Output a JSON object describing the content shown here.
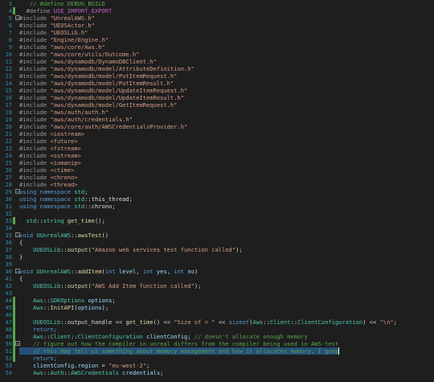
{
  "editor": {
    "theme": {
      "background": "#1e1e1e",
      "line_number": "#2b91af",
      "comment": "#57a64a",
      "preprocessor": "#9b9b9b",
      "macro": "#bd63c5",
      "string": "#d69d85",
      "keyword": "#569cd6",
      "type": "#4ec9b0",
      "function": "#dcdcaa",
      "variable": "#9cdcfe",
      "text": "#dcdcdc",
      "selection": "#264f78",
      "change_saved": "#57a64a",
      "change_unsaved": "#d7ba7d"
    },
    "lines": [
      {
        "n": "3",
        "bar": "",
        "fold": "",
        "sel": false,
        "tokens": [
          [
            "   // #define DEBUG_BUILD",
            "com"
          ]
        ]
      },
      {
        "n": "4",
        "bar": "green",
        "fold": "",
        "sel": false,
        "tokens": [
          [
            "  #define ",
            "pre"
          ],
          [
            "USE_IMPORT_EXPORT",
            "macro"
          ]
        ]
      },
      {
        "n": "5",
        "bar": "",
        "fold": "-",
        "sel": false,
        "tokens": [
          [
            "#include ",
            "pre"
          ],
          [
            "\"UnrealAWS.h\"",
            "str"
          ]
        ]
      },
      {
        "n": "6",
        "bar": "",
        "fold": "",
        "sel": false,
        "tokens": [
          [
            "#include ",
            "pre"
          ],
          [
            "\"UEOSActor.h\"",
            "str"
          ]
        ]
      },
      {
        "n": "7",
        "bar": "",
        "fold": "",
        "sel": false,
        "tokens": [
          [
            "#include ",
            "pre"
          ],
          [
            "\"UEOSLib.h\"",
            "str"
          ]
        ]
      },
      {
        "n": "8",
        "bar": "",
        "fold": "",
        "sel": false,
        "tokens": [
          [
            "#include ",
            "pre"
          ],
          [
            "\"Engine/Engine.h\"",
            "str"
          ]
        ]
      },
      {
        "n": "9",
        "bar": "",
        "fold": "",
        "sel": false,
        "tokens": [
          [
            "#include ",
            "pre"
          ],
          [
            "\"aws/core/Aws.h\"",
            "str"
          ]
        ]
      },
      {
        "n": "10",
        "bar": "",
        "fold": "",
        "sel": false,
        "tokens": [
          [
            "#include ",
            "pre"
          ],
          [
            "\"aws/core/utils/Outcome.h\"",
            "str"
          ]
        ]
      },
      {
        "n": "11",
        "bar": "",
        "fold": "",
        "sel": false,
        "tokens": [
          [
            "#include ",
            "pre"
          ],
          [
            "\"aws/dynamodb/DynamoDBClient.h\"",
            "str"
          ]
        ]
      },
      {
        "n": "12",
        "bar": "",
        "fold": "",
        "sel": false,
        "tokens": [
          [
            "#include ",
            "pre"
          ],
          [
            "\"aws/dynamodb/model/AttributeDefinition.h\"",
            "str"
          ]
        ]
      },
      {
        "n": "13",
        "bar": "",
        "fold": "",
        "sel": false,
        "tokens": [
          [
            "#include ",
            "pre"
          ],
          [
            "\"aws/dynamodb/model/PutItemRequest.h\"",
            "str"
          ]
        ]
      },
      {
        "n": "14",
        "bar": "",
        "fold": "",
        "sel": false,
        "tokens": [
          [
            "#include ",
            "pre"
          ],
          [
            "\"aws/dynamodb/model/PutItemResult.h\"",
            "str"
          ]
        ]
      },
      {
        "n": "15",
        "bar": "",
        "fold": "",
        "sel": false,
        "tokens": [
          [
            "#include ",
            "pre"
          ],
          [
            "\"aws/dynamodb/model/UpdateItemRequest.h\"",
            "str"
          ]
        ]
      },
      {
        "n": "16",
        "bar": "",
        "fold": "",
        "sel": false,
        "tokens": [
          [
            "#include ",
            "pre"
          ],
          [
            "\"aws/dynamodb/model/UpdateItemResult.h\"",
            "str"
          ]
        ]
      },
      {
        "n": "17",
        "bar": "",
        "fold": "",
        "sel": false,
        "tokens": [
          [
            "#include ",
            "pre"
          ],
          [
            "\"aws/dynamodb/model/GetItemRequest.h\"",
            "str"
          ]
        ]
      },
      {
        "n": "18",
        "bar": "",
        "fold": "",
        "sel": false,
        "tokens": [
          [
            "#include ",
            "pre"
          ],
          [
            "\"aws/auth/auth.h\"",
            "str"
          ]
        ]
      },
      {
        "n": "19",
        "bar": "",
        "fold": "",
        "sel": false,
        "tokens": [
          [
            "#include ",
            "pre"
          ],
          [
            "\"aws/auth/credentials.h\"",
            "str"
          ]
        ]
      },
      {
        "n": "20",
        "bar": "",
        "fold": "",
        "sel": false,
        "tokens": [
          [
            "#include ",
            "pre"
          ],
          [
            "\"aws/core/auth/AWSCredentialsProvider.h\"",
            "str"
          ]
        ]
      },
      {
        "n": "21",
        "bar": "",
        "fold": "",
        "sel": false,
        "tokens": [
          [
            "#include ",
            "pre"
          ],
          [
            "<iostream>",
            "str"
          ]
        ]
      },
      {
        "n": "22",
        "bar": "",
        "fold": "",
        "sel": false,
        "tokens": [
          [
            "#include ",
            "pre"
          ],
          [
            "<future>",
            "str"
          ]
        ]
      },
      {
        "n": "23",
        "bar": "",
        "fold": "",
        "sel": false,
        "tokens": [
          [
            "#include ",
            "pre"
          ],
          [
            "<fstream>",
            "str"
          ]
        ]
      },
      {
        "n": "24",
        "bar": "",
        "fold": "",
        "sel": false,
        "tokens": [
          [
            "#include ",
            "pre"
          ],
          [
            "<sstream>",
            "str"
          ]
        ]
      },
      {
        "n": "25",
        "bar": "",
        "fold": "",
        "sel": false,
        "tokens": [
          [
            "#include ",
            "pre"
          ],
          [
            "<iomanip>",
            "str"
          ]
        ]
      },
      {
        "n": "26",
        "bar": "",
        "fold": "",
        "sel": false,
        "tokens": [
          [
            "#include ",
            "pre"
          ],
          [
            "<ctime>",
            "str"
          ]
        ]
      },
      {
        "n": "27",
        "bar": "",
        "fold": "",
        "sel": false,
        "tokens": [
          [
            "#include ",
            "pre"
          ],
          [
            "<chrono>",
            "str"
          ]
        ]
      },
      {
        "n": "28",
        "bar": "",
        "fold": "",
        "sel": false,
        "tokens": [
          [
            "#include ",
            "pre"
          ],
          [
            "<thread>",
            "str"
          ]
        ]
      },
      {
        "n": "29",
        "bar": "",
        "fold": "-",
        "sel": false,
        "tokens": [
          [
            "using namespace ",
            "kw"
          ],
          [
            "std",
            "type"
          ],
          [
            ";",
            "txt"
          ]
        ]
      },
      {
        "n": "30",
        "bar": "",
        "fold": "",
        "sel": false,
        "tokens": [
          [
            "using namespace ",
            "kw"
          ],
          [
            "std",
            "type"
          ],
          [
            "::this_thread;",
            "txt"
          ]
        ]
      },
      {
        "n": "31",
        "bar": "",
        "fold": "",
        "sel": false,
        "tokens": [
          [
            "using namespace ",
            "kw"
          ],
          [
            "std",
            "type"
          ],
          [
            "::chrono;",
            "txt"
          ]
        ]
      },
      {
        "n": "32",
        "bar": "",
        "fold": "",
        "sel": false,
        "tokens": [
          [
            "",
            "txt"
          ]
        ]
      },
      {
        "n": "33",
        "bar": "green",
        "fold": "",
        "sel": false,
        "tokens": [
          [
            "  std",
            "type"
          ],
          [
            "::",
            "txt"
          ],
          [
            "string",
            "type"
          ],
          [
            " ",
            "txt"
          ],
          [
            "get_time",
            "fn"
          ],
          [
            "();",
            "txt"
          ]
        ]
      },
      {
        "n": "34",
        "bar": "",
        "fold": "",
        "sel": false,
        "tokens": [
          [
            "",
            "txt"
          ]
        ]
      },
      {
        "n": "35",
        "bar": "",
        "fold": "-",
        "sel": false,
        "tokens": [
          [
            "void ",
            "kw"
          ],
          [
            "UUnrealAWS",
            "type"
          ],
          [
            "::",
            "txt"
          ],
          [
            "awsTest",
            "fn"
          ],
          [
            "()",
            "txt"
          ]
        ]
      },
      {
        "n": "36",
        "bar": "",
        "fold": "",
        "sel": false,
        "tokens": [
          [
            "{",
            "txt"
          ]
        ]
      },
      {
        "n": "37",
        "bar": "",
        "fold": "",
        "sel": false,
        "tokens": [
          [
            "    ",
            "txt"
          ],
          [
            "UUEOSLib",
            "type"
          ],
          [
            "::",
            "txt"
          ],
          [
            "output",
            "fn"
          ],
          [
            "(",
            "txt"
          ],
          [
            "\"Amazon web services test function called\"",
            "str"
          ],
          [
            ");",
            "txt"
          ]
        ]
      },
      {
        "n": "38",
        "bar": "",
        "fold": "",
        "sel": false,
        "tokens": [
          [
            "}",
            "txt"
          ]
        ]
      },
      {
        "n": "39",
        "bar": "",
        "fold": "",
        "sel": false,
        "tokens": [
          [
            "",
            "txt"
          ]
        ]
      },
      {
        "n": "40",
        "bar": "",
        "fold": "-",
        "sel": false,
        "tokens": [
          [
            "void ",
            "kw"
          ],
          [
            "UUnrealAWS",
            "type"
          ],
          [
            "::",
            "txt"
          ],
          [
            "addItem",
            "fn"
          ],
          [
            "(",
            "txt"
          ],
          [
            "int ",
            "kw"
          ],
          [
            "level",
            "var"
          ],
          [
            ", ",
            "txt"
          ],
          [
            "int ",
            "kw"
          ],
          [
            "yes",
            "var"
          ],
          [
            ", ",
            "txt"
          ],
          [
            "int ",
            "kw"
          ],
          [
            "no",
            "var"
          ],
          [
            ")",
            "txt"
          ]
        ]
      },
      {
        "n": "41",
        "bar": "",
        "fold": "",
        "sel": false,
        "tokens": [
          [
            "{",
            "txt"
          ]
        ]
      },
      {
        "n": "42",
        "bar": "",
        "fold": "",
        "sel": false,
        "tokens": [
          [
            "    ",
            "txt"
          ],
          [
            "UUEOSLib",
            "type"
          ],
          [
            "::",
            "txt"
          ],
          [
            "output",
            "fn"
          ],
          [
            "(",
            "txt"
          ],
          [
            "\"AWS Add Item function called\"",
            "str"
          ],
          [
            ");",
            "txt"
          ]
        ]
      },
      {
        "n": "43",
        "bar": "",
        "fold": "",
        "sel": false,
        "tokens": [
          [
            "",
            "txt"
          ]
        ]
      },
      {
        "n": "44",
        "bar": "green",
        "fold": "",
        "sel": false,
        "tokens": [
          [
            "    ",
            "txt"
          ],
          [
            "Aws",
            "type"
          ],
          [
            "::",
            "txt"
          ],
          [
            "SDKOptions",
            "type"
          ],
          [
            " ",
            "txt"
          ],
          [
            "options",
            "var"
          ],
          [
            ";",
            "txt"
          ]
        ]
      },
      {
        "n": "45",
        "bar": "green",
        "fold": "",
        "sel": false,
        "tokens": [
          [
            "    ",
            "txt"
          ],
          [
            "Aws",
            "type"
          ],
          [
            "::",
            "txt"
          ],
          [
            "InitAPI",
            "fn"
          ],
          [
            "(",
            "txt"
          ],
          [
            "options",
            "var"
          ],
          [
            ");",
            "txt"
          ]
        ]
      },
      {
        "n": "46",
        "bar": "green",
        "fold": "",
        "sel": false,
        "tokens": [
          [
            "",
            "txt"
          ]
        ]
      },
      {
        "n": "47",
        "bar": "green",
        "fold": "",
        "sel": false,
        "tokens": [
          [
            "    ",
            "txt"
          ],
          [
            "UUEOSLib",
            "type"
          ],
          [
            "::",
            "txt"
          ],
          [
            "output_handle",
            "txt"
          ],
          [
            " << ",
            "txt"
          ],
          [
            "get_time",
            "fn"
          ],
          [
            "() << ",
            "txt"
          ],
          [
            "\"Size of = \"",
            "str"
          ],
          [
            " << ",
            "txt"
          ],
          [
            "sizeof",
            "kw"
          ],
          [
            "(",
            "txt"
          ],
          [
            "Aws",
            "type"
          ],
          [
            "::",
            "txt"
          ],
          [
            "Client",
            "type"
          ],
          [
            "::",
            "txt"
          ],
          [
            "ClientConfiguration",
            "type"
          ],
          [
            ") << ",
            "txt"
          ],
          [
            "\"\\n\"",
            "str"
          ],
          [
            ";",
            "txt"
          ]
        ]
      },
      {
        "n": "48",
        "bar": "green",
        "fold": "",
        "sel": false,
        "tokens": [
          [
            "    return;",
            "kw"
          ]
        ]
      },
      {
        "n": "49",
        "bar": "green",
        "fold": "",
        "sel": false,
        "tokens": [
          [
            "    ",
            "txt"
          ],
          [
            "Aws",
            "type"
          ],
          [
            "::",
            "txt"
          ],
          [
            "Client",
            "type"
          ],
          [
            "::",
            "txt"
          ],
          [
            "ClientConfiguration",
            "type"
          ],
          [
            " ",
            "txt"
          ],
          [
            "clientConfig",
            "var"
          ],
          [
            "; ",
            "txt"
          ],
          [
            "// doesn't allocate enough memory",
            "com"
          ]
        ]
      },
      {
        "n": "50",
        "bar": "green",
        "fold": "-",
        "sel": false,
        "tokens": [
          [
            "    // figure out how the compiler in unreal differs from the compiler being used in AWS-test",
            "com"
          ]
        ]
      },
      {
        "n": "51",
        "bar": "green",
        "fold": "",
        "sel": true,
        "tokens": [
          [
            "    // this may tell us something about memory management and how it allocates memory, I gues",
            "com"
          ]
        ]
      },
      {
        "n": "52",
        "bar": "green",
        "fold": "",
        "sel": false,
        "tokens": [
          [
            "    return;",
            "kw"
          ]
        ]
      },
      {
        "n": "53",
        "bar": "",
        "fold": "",
        "sel": false,
        "tokens": [
          [
            "    ",
            "txt"
          ],
          [
            "clientConfig",
            "var"
          ],
          [
            ".",
            "txt"
          ],
          [
            "region",
            "var"
          ],
          [
            " = ",
            "txt"
          ],
          [
            "\"eu-west-2\"",
            "str"
          ],
          [
            ";",
            "txt"
          ]
        ]
      },
      {
        "n": "54",
        "bar": "",
        "fold": "",
        "sel": false,
        "tokens": [
          [
            "    ",
            "txt"
          ],
          [
            "Aws",
            "type"
          ],
          [
            "::",
            "txt"
          ],
          [
            "Auth",
            "type"
          ],
          [
            "::",
            "txt"
          ],
          [
            "AWSCredentials",
            "type"
          ],
          [
            " ",
            "txt"
          ],
          [
            "credentials",
            "var"
          ],
          [
            ";",
            "txt"
          ]
        ]
      }
    ]
  }
}
